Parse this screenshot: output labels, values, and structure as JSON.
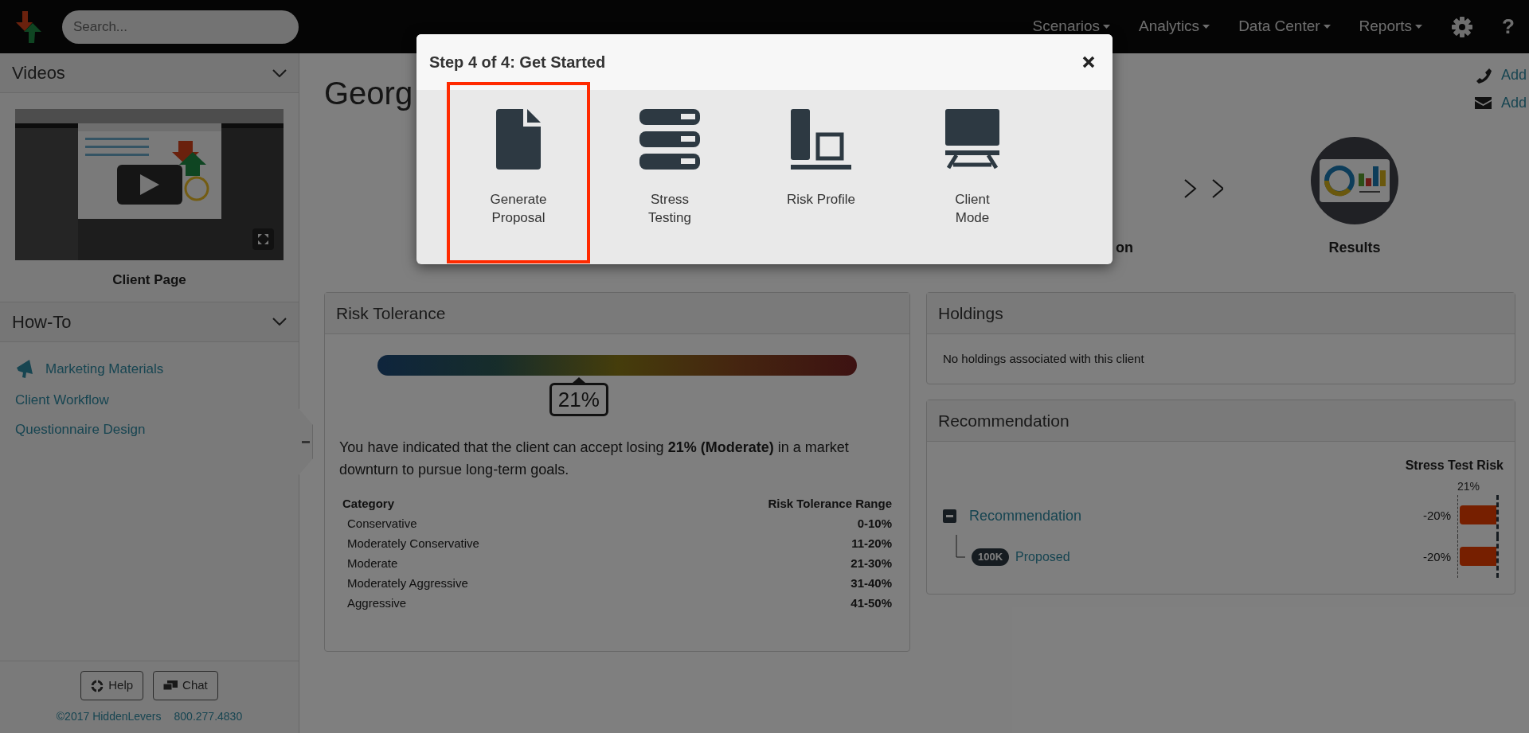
{
  "navbar": {
    "search": {
      "placeholder": "Search..."
    },
    "menus": [
      {
        "label": "Scenarios",
        "dropdown": true
      },
      {
        "label": "Analytics",
        "dropdown": true
      },
      {
        "label": "Data Center",
        "dropdown": true
      },
      {
        "label": "Reports",
        "dropdown": true
      }
    ],
    "help_label": "?"
  },
  "sidebar": {
    "sections": [
      {
        "title": "Videos",
        "expanded": true
      },
      {
        "title": "How-To",
        "expanded": true
      }
    ],
    "video": {
      "caption": "Client Page"
    },
    "links": [
      {
        "label": "Marketing Materials",
        "kind": "icon_link"
      },
      {
        "label": "Client Workflow",
        "kind": "link"
      },
      {
        "label": "Questionnaire Design",
        "kind": "link"
      }
    ],
    "footer_buttons": [
      {
        "label": "Help",
        "kind": "help"
      },
      {
        "label": "Chat",
        "kind": "chat"
      }
    ],
    "copyright": "©2017 HiddenLevers",
    "phone": "800.277.4830"
  },
  "client": {
    "name": "Georg",
    "contacts": [
      {
        "kind": "phone",
        "label": "Add"
      },
      {
        "kind": "email",
        "label": "Add"
      }
    ],
    "workflow": {
      "partial_label": "on",
      "last_step": "Results"
    }
  },
  "risk_tolerance": {
    "title": "Risk Tolerance",
    "level": 0.42,
    "reading": "21%",
    "summary": "You have indicated that the client can accept losing **21% (Moderate)** in a market downturn to pursue long-term goals.",
    "columns": [
      "Category",
      "Risk Tolerance Range"
    ],
    "rows": [
      {
        "category": "Conservative",
        "range": "0-10%"
      },
      {
        "category": "Moderately Conservative",
        "range": "11-20%"
      },
      {
        "category": "Moderate",
        "range": "21-30%"
      },
      {
        "category": "Moderately Aggressive",
        "range": "31-40%"
      },
      {
        "category": "Aggressive",
        "range": "41-50%"
      }
    ]
  },
  "holdings": {
    "title": "Holdings",
    "message": "No holdings associated with this client"
  },
  "recommendation": {
    "title": "Recommendation",
    "column": "Stress Test Risk",
    "threshold": "21%",
    "rows": [
      {
        "label": "Recommendation",
        "expanded": true,
        "reading": "-20%",
        "level": 0.95,
        "children": [
          {
            "label": "Proposed",
            "badge": "100K",
            "reading": "-20%",
            "level": 0.95
          }
        ]
      }
    ]
  },
  "modal": {
    "title": "Step 4 of 4: Get Started",
    "options": [
      {
        "label": "Generate\nProposal",
        "kind": "document",
        "selected": true
      },
      {
        "label": "Stress\nTesting",
        "kind": "stack",
        "selected": false
      },
      {
        "label": "Risk Profile",
        "kind": "profile",
        "selected": false
      },
      {
        "label": "Client\nMode",
        "kind": "presentation",
        "selected": false
      }
    ]
  }
}
